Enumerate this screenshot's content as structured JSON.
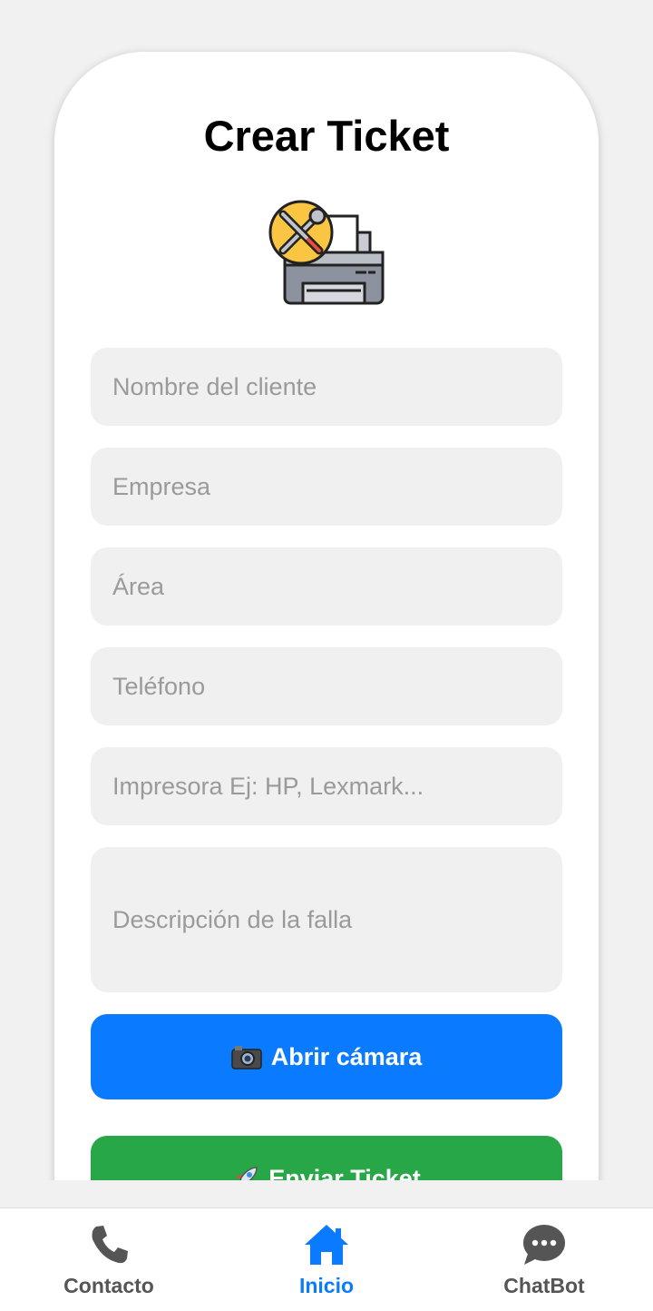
{
  "form": {
    "title": "Crear Ticket",
    "fields": {
      "client_name": {
        "placeholder": "Nombre del cliente",
        "value": ""
      },
      "company": {
        "placeholder": "Empresa",
        "value": ""
      },
      "area": {
        "placeholder": "Área",
        "value": ""
      },
      "phone": {
        "placeholder": "Teléfono",
        "value": ""
      },
      "printer": {
        "placeholder": "Impresora Ej: HP, Lexmark...",
        "value": ""
      },
      "description": {
        "placeholder": "Descripción de la falla",
        "value": ""
      }
    },
    "camera_button": {
      "label": "Abrir cámara",
      "icon": "camera-icon"
    },
    "send_button": {
      "label": "Enviar Ticket",
      "icon": "rocket-icon"
    }
  },
  "logo": {
    "icon": "printer-repair-icon"
  },
  "bottom_nav": {
    "items": [
      {
        "label": "Contacto",
        "icon": "phone-icon",
        "active": false
      },
      {
        "label": "Inicio",
        "icon": "home-icon",
        "active": true
      },
      {
        "label": "ChatBot",
        "icon": "chat-icon",
        "active": false
      }
    ]
  },
  "colors": {
    "primary": "#0a7bff",
    "success": "#28a748",
    "inactive_nav": "#555555",
    "background": "#f1f1f1",
    "field_background": "#f0f0f0"
  }
}
